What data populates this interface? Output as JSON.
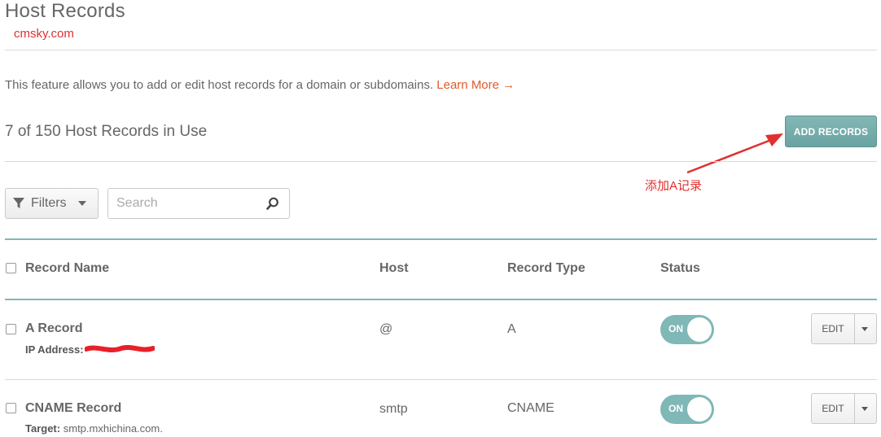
{
  "page": {
    "title": "Host Records",
    "watermark": "cmsky.com",
    "description": "This feature allows you to add or edit host records for a domain or subdomains.",
    "learn_more": "Learn More →",
    "records_count": "7 of 150 Host Records in Use",
    "add_button": "ADD RECORDS",
    "annotation": "添加A记录"
  },
  "toolbar": {
    "filters_label": "Filters",
    "search_placeholder": "Search"
  },
  "table": {
    "headers": [
      "Record Name",
      "Host",
      "Record Type",
      "Status"
    ],
    "rows": [
      {
        "name": "A Record",
        "detail_label": "IP Address:",
        "detail_value": "",
        "host": "@",
        "type": "A",
        "status": "ON",
        "edit": "EDIT"
      },
      {
        "name": "CNAME Record",
        "detail_label": "Target:",
        "detail_value": "smtp.mxhichina.com.",
        "host": "smtp",
        "type": "CNAME",
        "status": "ON",
        "edit": "EDIT"
      }
    ]
  },
  "colors": {
    "accent": "#7fb8b6",
    "link": "#e05a2b",
    "annotation": "#e03030"
  }
}
